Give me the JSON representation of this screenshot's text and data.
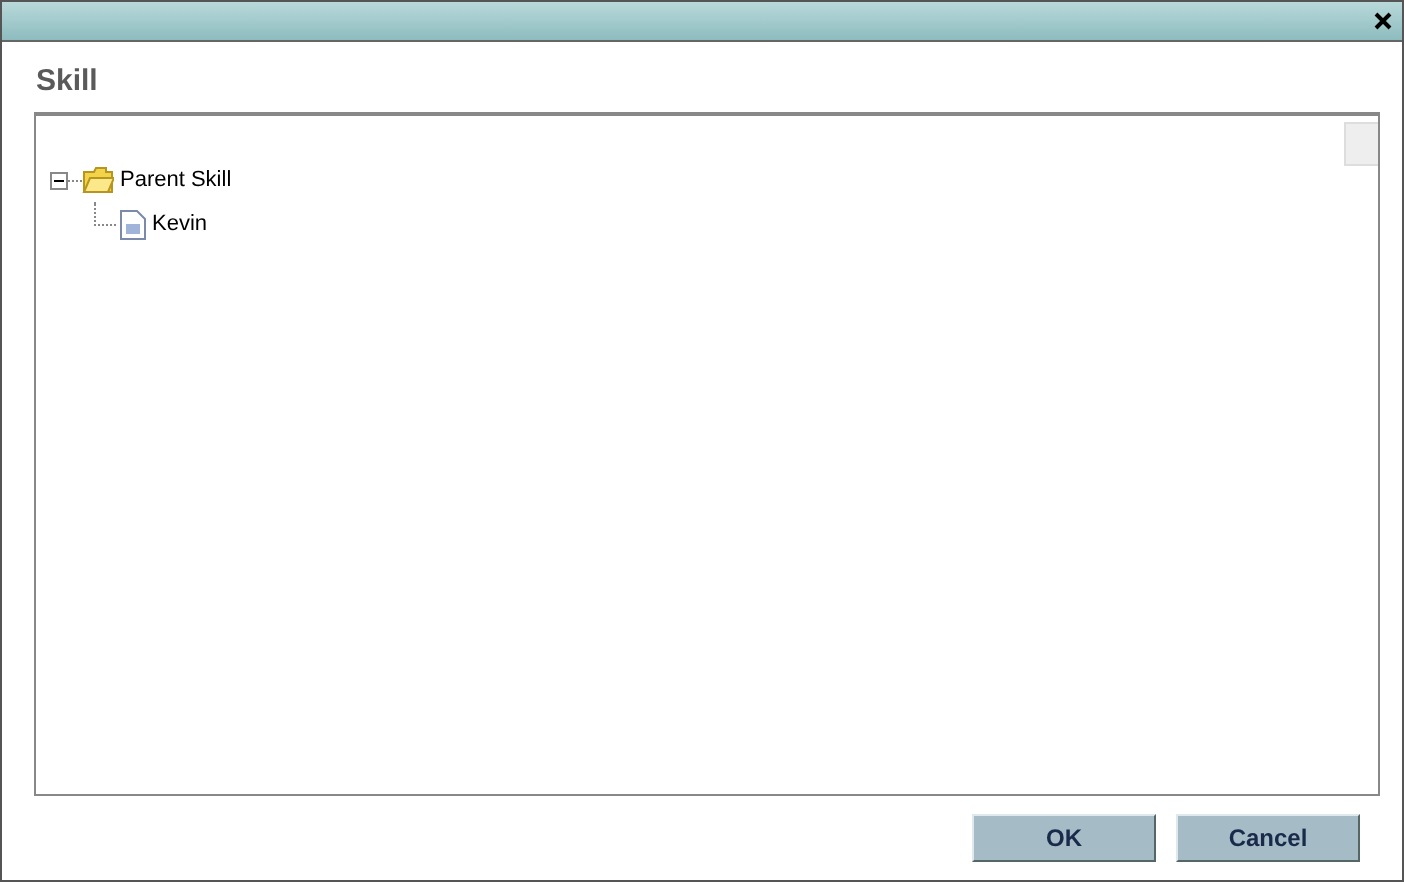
{
  "heading": "Skill",
  "tree": [
    {
      "label": "Parent Skill",
      "kind": "folder",
      "expanded": true,
      "children": [
        {
          "label": "Kevin",
          "kind": "file"
        }
      ]
    }
  ],
  "buttons": [
    "OK",
    "Cancel"
  ]
}
